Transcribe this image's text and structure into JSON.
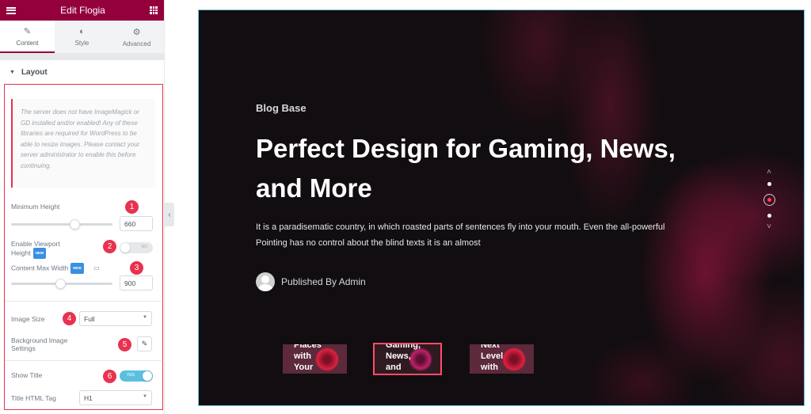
{
  "panel": {
    "title": "Edit Flogia",
    "tabs": [
      {
        "label": "Content",
        "icon": "pencil-icon"
      },
      {
        "label": "Style",
        "icon": "contrast-icon"
      },
      {
        "label": "Advanced",
        "icon": "gear-icon"
      }
    ],
    "section": "Layout",
    "notice": "The server does not have ImageMagick or GD installed and/or enabled! Any of these libraries are required for WordPress to be able to resize images. Please contact your server administrator to enable this before continuing.",
    "min_height": {
      "label": "Minimum Height",
      "value": "660",
      "slider_fraction": 0.6
    },
    "viewport": {
      "label_line1": "Enable Viewport",
      "label_line2": "Height",
      "new_badge": "NEW",
      "state": "NO"
    },
    "max_width": {
      "label": "Content Max Width",
      "new_badge": "NEW",
      "value": "900",
      "slider_fraction": 0.45
    },
    "image_size": {
      "label": "Image Size",
      "value": "Full"
    },
    "bg_settings": {
      "label_line1": "Background Image",
      "label_line2": "Settings"
    },
    "show_title": {
      "label": "Show Title",
      "state": "YES"
    },
    "title_tag": {
      "label": "Title HTML Tag",
      "value": "H1"
    },
    "annotations": [
      "1",
      "2",
      "3",
      "4",
      "5",
      "6"
    ]
  },
  "preview": {
    "category": "Blog Base",
    "headline_line1": "Perfect Design for Gaming, News,",
    "headline_line2": "and More",
    "description_line1": "It is a paradisematic country, in which roasted parts of sentences fly into your mouth. Even the all-powerful",
    "description_line2": "Pointing has no control about the blind texts it is an almost",
    "author": "Published By Admin",
    "thumbnails": [
      {
        "lines": [
          "Places",
          "with",
          "Your"
        ]
      },
      {
        "lines": [
          "Gaming,",
          "News,",
          "and"
        ],
        "selected": true
      },
      {
        "lines": [
          "Next",
          "Level",
          "with"
        ]
      }
    ],
    "nav": {
      "up": "˄",
      "down": "˅",
      "active_index": 1,
      "count": 3
    }
  },
  "colors": {
    "brand": "#93003c",
    "highlight": "#e8324f",
    "toggle_on": "#5bc0de"
  }
}
